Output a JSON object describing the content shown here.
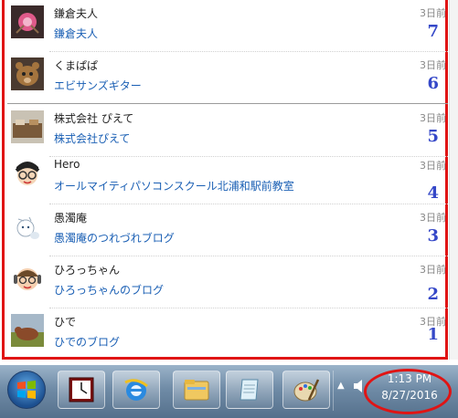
{
  "feed": {
    "items": [
      {
        "name": "鎌倉夫人",
        "link": "鎌倉夫人",
        "time": "3日前",
        "number": "7"
      },
      {
        "name": "くまぱぱ",
        "link": "エビサンズギター",
        "time": "3日前",
        "number": "6"
      },
      {
        "name": "株式会社 ぴえて",
        "link": "株式会社ぴえて",
        "time": "3日前",
        "number": "5"
      },
      {
        "name": "Hero",
        "link": "オールマイティパソコンスクール北浦和駅前教室",
        "time": "3日前",
        "number": "4"
      },
      {
        "name": "愚濁庵",
        "link": "愚濁庵のつれづれブログ",
        "time": "3日前",
        "number": "3"
      },
      {
        "name": "ひろっちゃん",
        "link": "ひろっちゃんのブログ",
        "time": "3日前",
        "number": "2"
      },
      {
        "name": "ひで",
        "link": "ひでのブログ",
        "time": "3日前",
        "number": "1"
      }
    ]
  },
  "taskbar": {
    "clock_time": "1:13 PM",
    "clock_date": "8/27/2016",
    "tray_arrow": "▲"
  },
  "colors": {
    "annotation_red": "#e01414",
    "link_blue": "#1a5fb4",
    "number_blue": "#3548c8"
  }
}
